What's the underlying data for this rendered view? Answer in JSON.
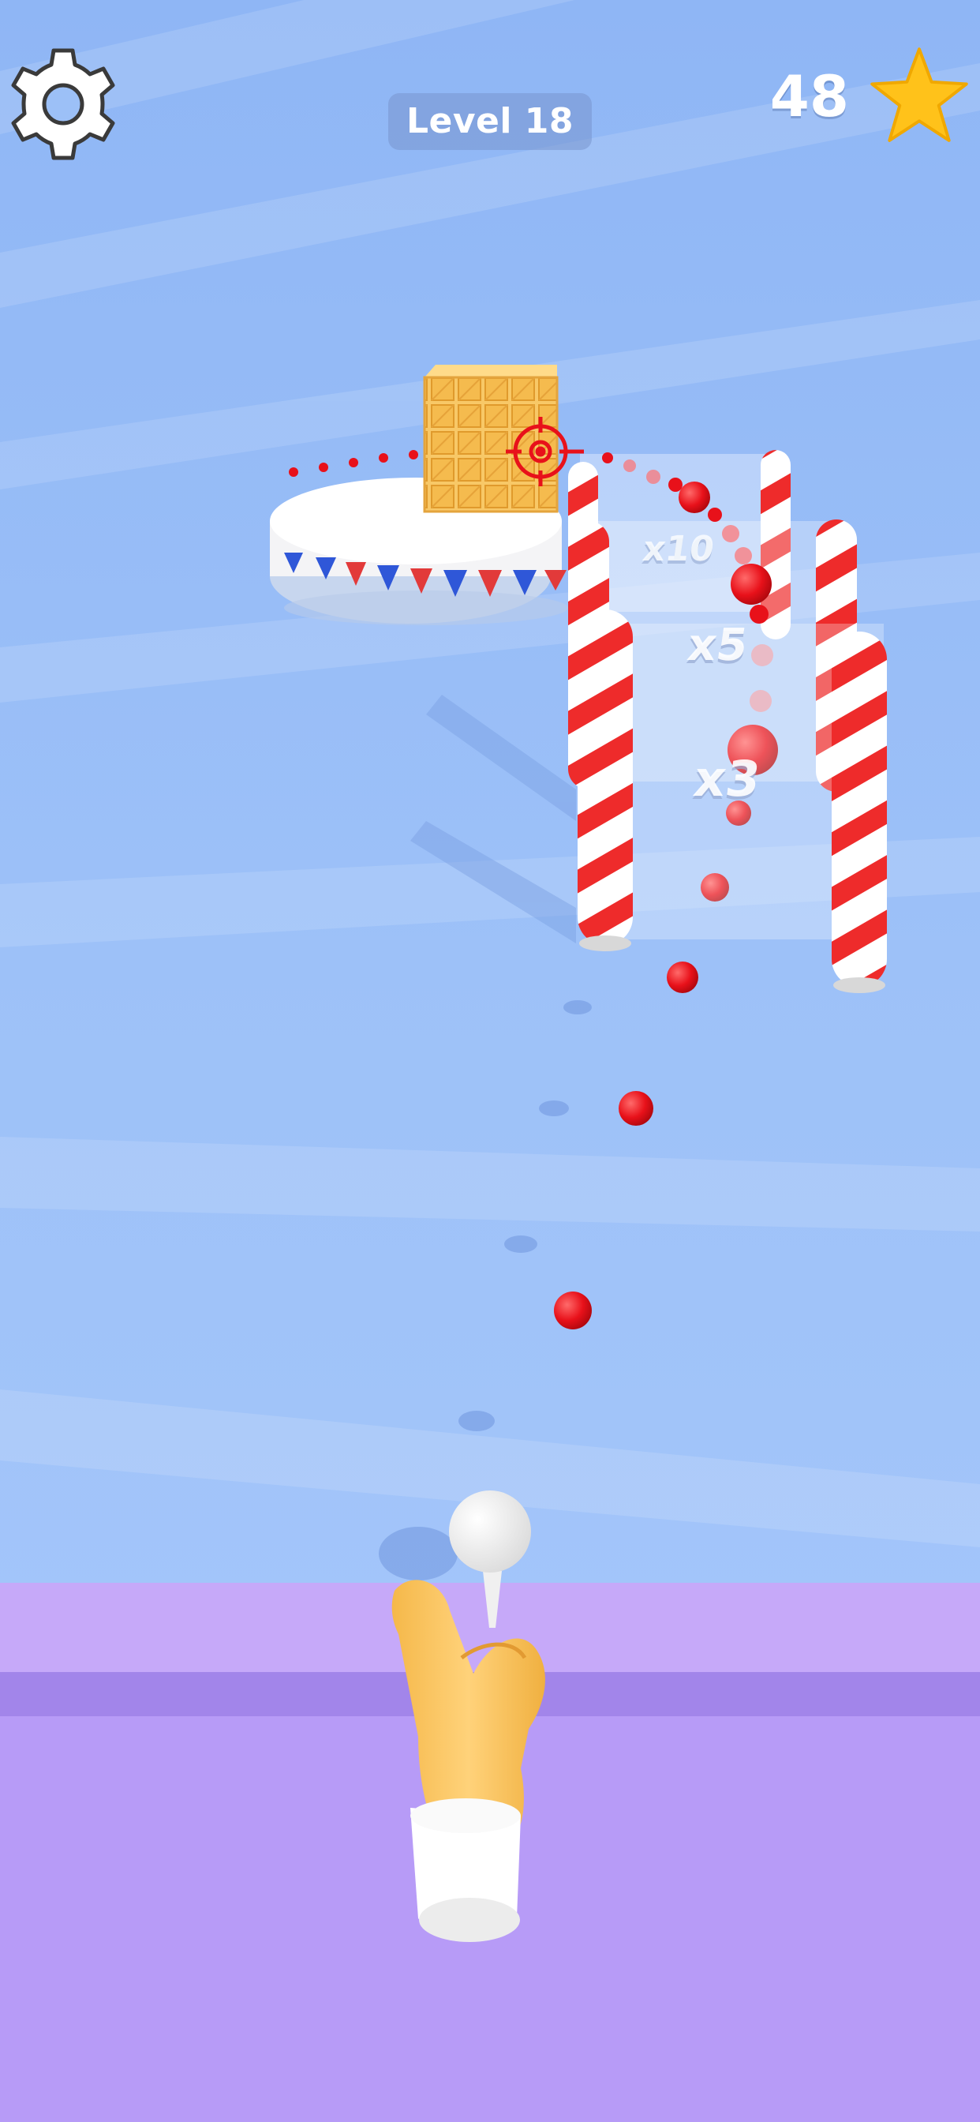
{
  "hud": {
    "level_label": "Level 18",
    "score": "48",
    "settings_icon": "gear-icon",
    "score_icon": "star-icon"
  },
  "gates": [
    {
      "label": "x10"
    },
    {
      "label": "x5"
    },
    {
      "label": "x3"
    }
  ],
  "colors": {
    "sky": "#9cc0f7",
    "floor": "#b79bf7",
    "ball_trail": "#e8111a",
    "star": "#ffc21a",
    "waffle": "#f5c158"
  }
}
